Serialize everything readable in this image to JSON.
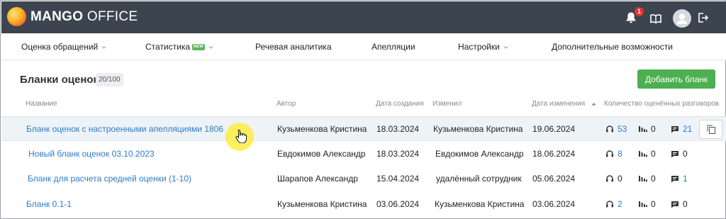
{
  "brand": {
    "name_bold": "MANGO",
    "name_light": " OFFICE"
  },
  "header": {
    "notifications_count": "1"
  },
  "nav": {
    "items": [
      {
        "label": "Оценка обращений",
        "has_dropdown": true
      },
      {
        "label": "Статистика",
        "badge": "NEW",
        "has_dropdown": true
      },
      {
        "label": "Речевая аналитика",
        "has_dropdown": false
      },
      {
        "label": "Апелляции",
        "has_dropdown": false
      },
      {
        "label": "Настройки",
        "has_dropdown": true
      },
      {
        "label": "Дополнительные возможности",
        "has_dropdown": false
      }
    ]
  },
  "page": {
    "title": "Бланки оценок",
    "count": "20/100",
    "add_button": "Добавить бланк"
  },
  "table": {
    "columns": [
      "Название",
      "Автор",
      "Дата создания",
      "Изменил",
      "Дата изменения",
      "Количество оценённых разговоров"
    ],
    "sorted_column": "Дата изменения",
    "rows": [
      {
        "name": "Бланк оценок с настроенными апелляциями 1806",
        "author": "Кузьменкова Кристина",
        "created": "18.03.2024",
        "modified_by": "Кузьменкова Кристина",
        "modified": "19.06.2024",
        "calls": "53",
        "calls_link": true,
        "mid": "0",
        "comments": "21",
        "comments_link": true
      },
      {
        "name": "Новый бланк оценок 03.10.2023",
        "author": "Евдокимов Александр",
        "created": "18.03.2024",
        "modified_by": "Евдокимов Александр",
        "modified": "18.06.2024",
        "calls": "8",
        "calls_link": true,
        "mid": "0",
        "comments": "0",
        "comments_link": false
      },
      {
        "name": "Бланк для расчета средней оценки (1-10)",
        "author": "Шарапов Александр",
        "created": "15.04.2024",
        "modified_by": "удалённый сотрудник",
        "modified": "05.06.2024",
        "calls": "0",
        "calls_link": false,
        "mid": "0",
        "comments": "1",
        "comments_link": true
      },
      {
        "name": "Бланк 0.1-1",
        "author": "Кузьменкова Кристина",
        "created": "03.06.2024",
        "modified_by": "Кузьменкова Кристина",
        "modified": "03.06.2024",
        "calls": "2",
        "calls_link": true,
        "mid": "0",
        "comments": "0",
        "comments_link": false
      }
    ]
  },
  "colors": {
    "topbar": "#3c4450",
    "accent_green": "#4caf50",
    "link_blue": "#2d7cc9"
  }
}
